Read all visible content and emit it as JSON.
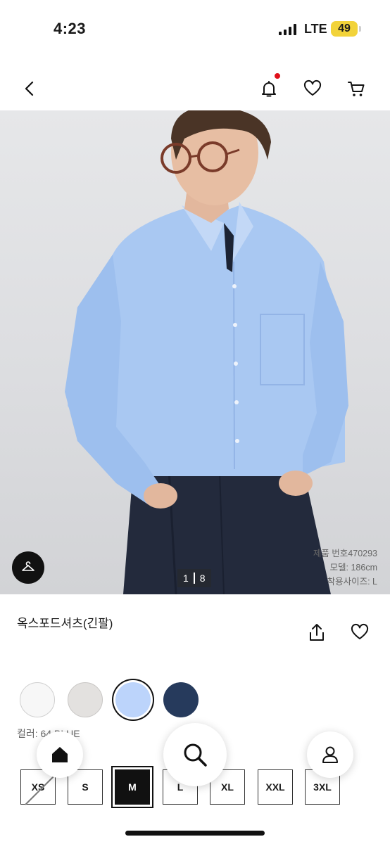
{
  "status_bar": {
    "time": "4:23",
    "network": "LTE",
    "battery": "49"
  },
  "header": {
    "icons": [
      "back-icon",
      "bell-icon",
      "heart-icon",
      "cart-icon"
    ]
  },
  "gallery": {
    "page_current": "1",
    "page_total": "8",
    "model_info": [
      "제품 번호470293",
      "모델: 186cm",
      "착용사이즈: L"
    ]
  },
  "product": {
    "name": "옥스포드셔츠(긴팔)",
    "color_label": "컬러: 64 BLUE"
  },
  "colors": [
    {
      "name": "white",
      "hex": "#f7f7f7",
      "selected": false
    },
    {
      "name": "gray",
      "hex": "#e3e1df",
      "selected": false
    },
    {
      "name": "blue",
      "hex": "#bcd4fb",
      "selected": true
    },
    {
      "name": "navy",
      "hex": "#263a5c",
      "selected": false
    }
  ],
  "sizes": [
    {
      "label": "XS",
      "state": "out_of_stock"
    },
    {
      "label": "S",
      "state": "available"
    },
    {
      "label": "M",
      "state": "selected"
    },
    {
      "label": "L",
      "state": "available"
    },
    {
      "label": "XL",
      "state": "available"
    },
    {
      "label": "XXL",
      "state": "available"
    },
    {
      "label": "3XL",
      "state": "available"
    }
  ],
  "bottom_nav": [
    "home-icon",
    "search-icon",
    "user-icon"
  ]
}
